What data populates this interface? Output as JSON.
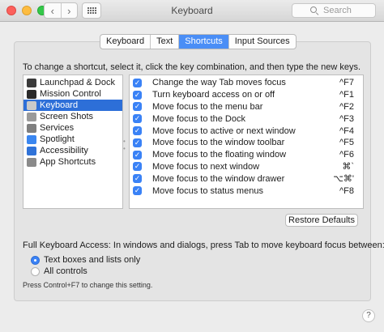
{
  "window": {
    "title": "Keyboard",
    "search_placeholder": "Search",
    "back_glyph": "‹",
    "forward_glyph": "›"
  },
  "tabs": [
    {
      "label": "Keyboard",
      "active": false
    },
    {
      "label": "Text",
      "active": false
    },
    {
      "label": "Shortcuts",
      "active": true
    },
    {
      "label": "Input Sources",
      "active": false
    }
  ],
  "instructions": "To change a shortcut, select it, click the key combination, and then type the new keys.",
  "categories": [
    {
      "label": "Launchpad & Dock",
      "icon": "launchpad-icon",
      "color": "#3b3b3b",
      "selected": false
    },
    {
      "label": "Mission Control",
      "icon": "mission-control-icon",
      "color": "#2a2a2a",
      "selected": false
    },
    {
      "label": "Keyboard",
      "icon": "keyboard-icon",
      "color": "#c9c9c9",
      "selected": true
    },
    {
      "label": "Screen Shots",
      "icon": "screenshot-icon",
      "color": "#9a9a9a",
      "selected": false
    },
    {
      "label": "Services",
      "icon": "services-gear-icon",
      "color": "#7f7f7f",
      "selected": false
    },
    {
      "label": "Spotlight",
      "icon": "spotlight-icon",
      "color": "#3a86f0",
      "selected": false
    },
    {
      "label": "Accessibility",
      "icon": "accessibility-icon",
      "color": "#2f72d8",
      "selected": false
    },
    {
      "label": "App Shortcuts",
      "icon": "app-shortcuts-icon",
      "color": "#8a8a8a",
      "selected": false
    }
  ],
  "shortcuts": [
    {
      "name": "Change the way Tab moves focus",
      "keys": "^F7",
      "checked": true
    },
    {
      "name": "Turn keyboard access on or off",
      "keys": "^F1",
      "checked": true
    },
    {
      "name": "Move focus to the menu bar",
      "keys": "^F2",
      "checked": true
    },
    {
      "name": "Move focus to the Dock",
      "keys": "^F3",
      "checked": true
    },
    {
      "name": "Move focus to active or next window",
      "keys": "^F4",
      "checked": true
    },
    {
      "name": "Move focus to the window toolbar",
      "keys": "^F5",
      "checked": true
    },
    {
      "name": "Move focus to the floating window",
      "keys": "^F6",
      "checked": true
    },
    {
      "name": "Move focus to next window",
      "keys": "⌘`",
      "checked": true
    },
    {
      "name": "Move focus to the window drawer",
      "keys": "⌥⌘'",
      "checked": true
    },
    {
      "name": "Move focus to status menus",
      "keys": "^F8",
      "checked": true
    }
  ],
  "restore_button": "Restore Defaults",
  "full_keyboard_access": {
    "label": "Full Keyboard Access: In windows and dialogs, press Tab to move keyboard focus between:",
    "options": [
      {
        "label": "Text boxes and lists only",
        "selected": true
      },
      {
        "label": "All controls",
        "selected": false
      }
    ],
    "hint": "Press Control+F7 to change this setting."
  },
  "help_label": "?",
  "colors": {
    "accent": "#3a82f6",
    "selection": "#2d6fd8",
    "tab_active": "#4a8ef6"
  }
}
